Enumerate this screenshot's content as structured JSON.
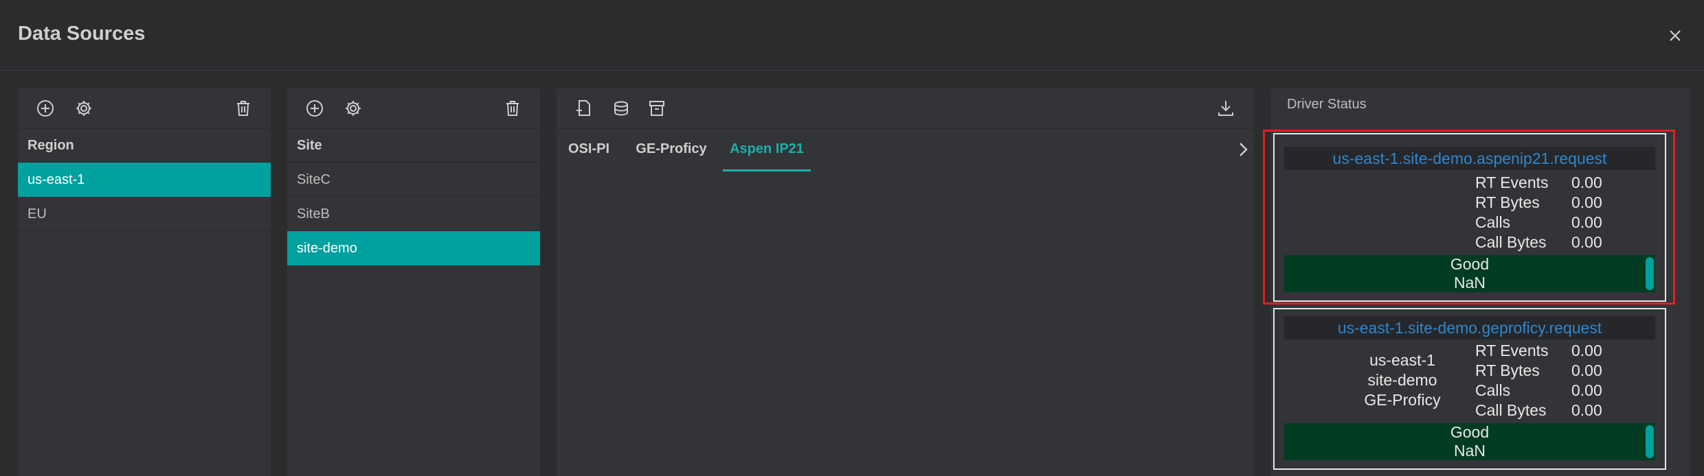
{
  "dialog": {
    "title": "Data Sources",
    "close_icon": "close-icon"
  },
  "region": {
    "header": "Region",
    "items": [
      {
        "label": "us-east-1",
        "selected": true
      },
      {
        "label": "EU",
        "selected": false
      }
    ]
  },
  "site": {
    "header": "Site",
    "items": [
      {
        "label": "SiteC",
        "selected": false
      },
      {
        "label": "SiteB",
        "selected": false
      },
      {
        "label": "site-demo",
        "selected": true
      }
    ]
  },
  "drivers": {
    "tabs": [
      {
        "label": "OSI-PI",
        "active": false
      },
      {
        "label": "GE-Proficy",
        "active": false
      },
      {
        "label": "Aspen IP21",
        "active": true
      }
    ]
  },
  "status": {
    "title": "Driver Status",
    "cards": [
      {
        "name": "us-east-1.site-demo.aspenip21.request",
        "info": [],
        "metrics": [
          {
            "label": "RT Events",
            "value": "0.00"
          },
          {
            "label": "RT Bytes",
            "value": "0.00"
          },
          {
            "label": "Calls",
            "value": "0.00"
          },
          {
            "label": "Call Bytes",
            "value": "0.00"
          }
        ],
        "health": "Good",
        "health_value": "NaN"
      },
      {
        "name": "us-east-1.site-demo.geproficy.request",
        "info": [
          "us-east-1",
          "site-demo",
          "GE-Proficy"
        ],
        "metrics": [
          {
            "label": "RT Events",
            "value": "0.00"
          },
          {
            "label": "RT Bytes",
            "value": "0.00"
          },
          {
            "label": "Calls",
            "value": "0.00"
          },
          {
            "label": "Call Bytes",
            "value": "0.00"
          }
        ],
        "health": "Good",
        "health_value": "NaN"
      }
    ]
  },
  "colors": {
    "accent": "#00a19f",
    "link": "#2f86cf",
    "health_bg": "#003c22",
    "highlight": "#e02020"
  }
}
